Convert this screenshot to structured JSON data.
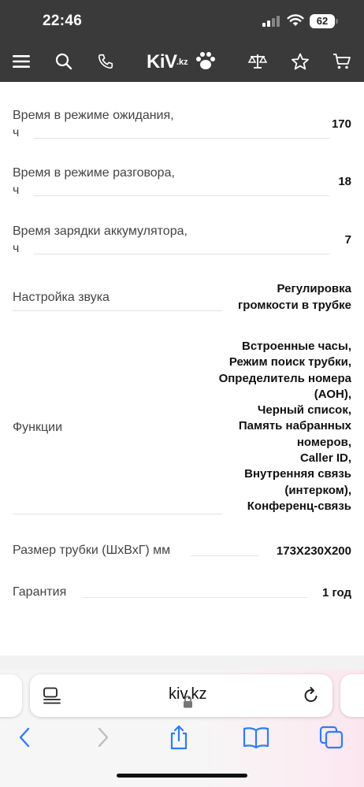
{
  "status_bar": {
    "time": "22:46",
    "battery": "62"
  },
  "header": {
    "logo_text": "KiV",
    "logo_suffix": ".kz"
  },
  "specs": [
    {
      "label_lines": [
        "Время в режиме ожидания,",
        "ч"
      ],
      "value_lines": [
        "170"
      ]
    },
    {
      "label_lines": [
        "Время в режиме разговора,",
        "ч"
      ],
      "value_lines": [
        "18"
      ]
    },
    {
      "label_lines": [
        "Время зарядки аккумулятора,",
        "ч"
      ],
      "value_lines": [
        "7"
      ]
    },
    {
      "label_lines": [
        "Настройка звука"
      ],
      "value_lines": [
        "Регулировка",
        "громкости в трубке"
      ]
    },
    {
      "label_lines": [
        "Функции"
      ],
      "value_lines": [
        "Встроенные часы,",
        "Режим поиск трубки,",
        "Определитель номера",
        "(АОН),",
        "Черный список,",
        "Память набранных",
        "номеров,",
        "Caller ID,",
        "Внутренняя связь",
        "(интерком),",
        "Конференц-связь"
      ]
    },
    {
      "label_lines": [
        "Размер трубки (ШхВхГ) мм"
      ],
      "value_lines": [
        "173Х230Х200"
      ]
    },
    {
      "label_lines": [
        "Гарантия"
      ],
      "value_lines": [
        "1 год"
      ]
    }
  ],
  "browser": {
    "url": "kiv.kz"
  },
  "colors": {
    "header_bg": "#3a3a3a",
    "link_blue": "#2f7cf6"
  }
}
